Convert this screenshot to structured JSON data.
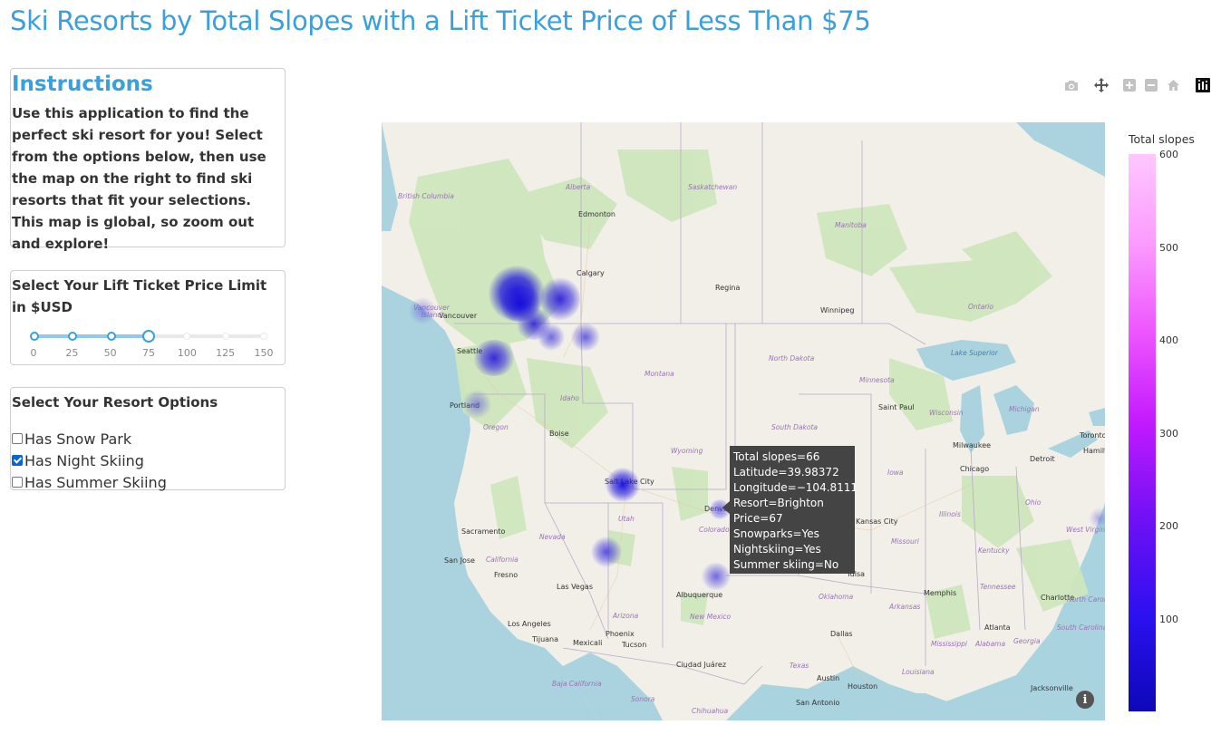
{
  "title": "Ski Resorts by Total Slopes with a Lift Ticket Price of Less Than $75",
  "instructions": {
    "heading": "Instructions",
    "body": "Use this application to find the perfect ski resort for you! Select from the options below, then use the map on the right to find ski resorts that fit your selections. This map is global, so zoom out and explore!"
  },
  "price_slider": {
    "label": "Select Your Lift Ticket Price Limit in $USD",
    "marks": [
      "0",
      "25",
      "50",
      "75",
      "100",
      "125",
      "150"
    ],
    "value": 75,
    "min": 0,
    "max": 150
  },
  "resort_options": {
    "label": "Select Your Resort Options",
    "items": [
      {
        "label": "Has Snow Park",
        "checked": false
      },
      {
        "label": "Has Night Skiing",
        "checked": true
      },
      {
        "label": "Has Summer Skiing",
        "checked": false
      }
    ]
  },
  "modebar": [
    "camera-icon",
    "pan-icon",
    "zoom-in-icon",
    "zoom-out-icon",
    "home-icon",
    "plotly-logo-icon"
  ],
  "map": {
    "cities": [
      "Edmonton",
      "Calgary",
      "Regina",
      "Winnipeg",
      "Vancouver",
      "Seattle",
      "Portland",
      "Boise",
      "Salt Lake City",
      "Denver",
      "Kansas City",
      "Sacramento",
      "San Jose",
      "Fresno",
      "Las Vegas",
      "Los Angeles",
      "Tijuana",
      "Phoenix",
      "Tucson",
      "Mexicali",
      "Albuquerque",
      "Tulsa",
      "Dallas",
      "Austin",
      "Houston",
      "San Antonio",
      "Memphis",
      "Atlanta",
      "Charlotte",
      "Jacksonville",
      "Chicago",
      "Milwaukee",
      "Detroit",
      "Toronto",
      "Hamilton",
      "Saint Paul",
      "Ciudad Juárez"
    ],
    "regions": [
      "British Columbia",
      "Alberta",
      "Saskatchewan",
      "Manitoba",
      "Ontario",
      "Montana",
      "North Dakota",
      "South Dakota",
      "Minnesota",
      "Wisconsin",
      "Michigan",
      "Iowa",
      "Illinois",
      "Ohio",
      "Missouri",
      "Kentucky",
      "Tennessee",
      "Wyoming",
      "Idaho",
      "Oregon",
      "Nevada",
      "Utah",
      "Colorado",
      "California",
      "Arizona",
      "New Mexico",
      "Oklahoma",
      "Arkansas",
      "Texas",
      "Louisiana",
      "Mississippi",
      "Alabama",
      "Georgia",
      "South Carolina",
      "North Carolina",
      "West Virginia",
      "Vancouver Island",
      "Lake Superior",
      "Sonora",
      "Chihuahua",
      "Baja California"
    ]
  },
  "tooltip": {
    "lines": [
      "Total slopes=66",
      "Latitude=39.98372",
      "Longitude=−104.8111",
      "Resort=Brighton",
      "Price=67",
      "Snowparks=Yes",
      "Nightskiing=Yes",
      "Summer skiing=No"
    ]
  },
  "colorbar": {
    "title": "Total slopes",
    "ticks": [
      "600",
      "500",
      "400",
      "300",
      "200",
      "100"
    ],
    "colors": [
      "#0d08b8",
      "#2b10f0",
      "#7210f5",
      "#c31aff",
      "#ee55ff",
      "#fb9bff",
      "#ffc7ff"
    ]
  },
  "info_icon": "info-icon"
}
